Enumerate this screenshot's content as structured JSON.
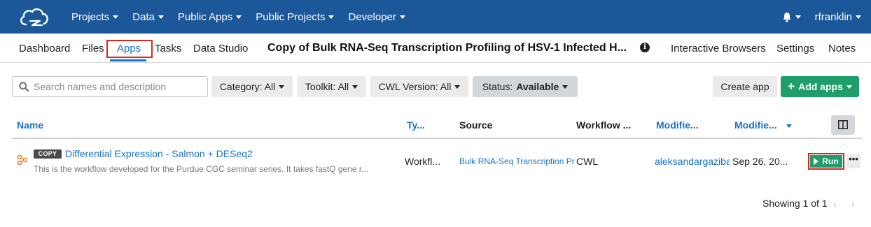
{
  "topnav": {
    "menu": [
      {
        "label": "Projects"
      },
      {
        "label": "Data"
      },
      {
        "label": "Public Apps"
      },
      {
        "label": "Public Projects"
      },
      {
        "label": "Developer"
      }
    ],
    "user": "rfranklin"
  },
  "subnav": {
    "tabs_left": [
      "Dashboard",
      "Files",
      "Apps",
      "Tasks",
      "Data Studio"
    ],
    "active_tab": "Apps",
    "project_title": "Copy of Bulk RNA-Seq Transcription Profiling of HSV-1 Infected H...",
    "tabs_right": [
      "Interactive Browsers",
      "Settings",
      "Notes"
    ]
  },
  "filters": {
    "search_placeholder": "Search names and description",
    "category": "Category: All",
    "toolkit": "Toolkit: All",
    "cwl_version": "CWL Version: All",
    "status_label": "Status:",
    "status_value": "Available",
    "create_app": "Create app",
    "add_apps": "Add apps"
  },
  "table": {
    "headers": {
      "name": "Name",
      "type": "Ty...",
      "source": "Source",
      "workflow": "Workflow ...",
      "modified_by": "Modifie...",
      "modified_on": "Modifie..."
    },
    "rows": [
      {
        "badge": "COPY",
        "name": "Differential Expression - Salmon + DESeq2",
        "description": "This is the workflow developed for the Purdue CGC seminar series. It takes fastQ gene r...",
        "type": "Workfl...",
        "source": "Bulk RNA-Seq Transcription Pr",
        "workflow_lang": "CWL",
        "modified_by": "aleksandargazibara",
        "modified_on": "Sep 26, 20...",
        "run_label": "Run",
        "more_label": "•••"
      }
    ]
  },
  "pagination": {
    "showing": "Showing 1 of 1",
    "prev": "‹",
    "next": "›"
  },
  "colors": {
    "nav_bg": "#1c5799",
    "link": "#1a73c8",
    "primary_green": "#1e9e6a",
    "highlight_red": "#d9261c"
  }
}
